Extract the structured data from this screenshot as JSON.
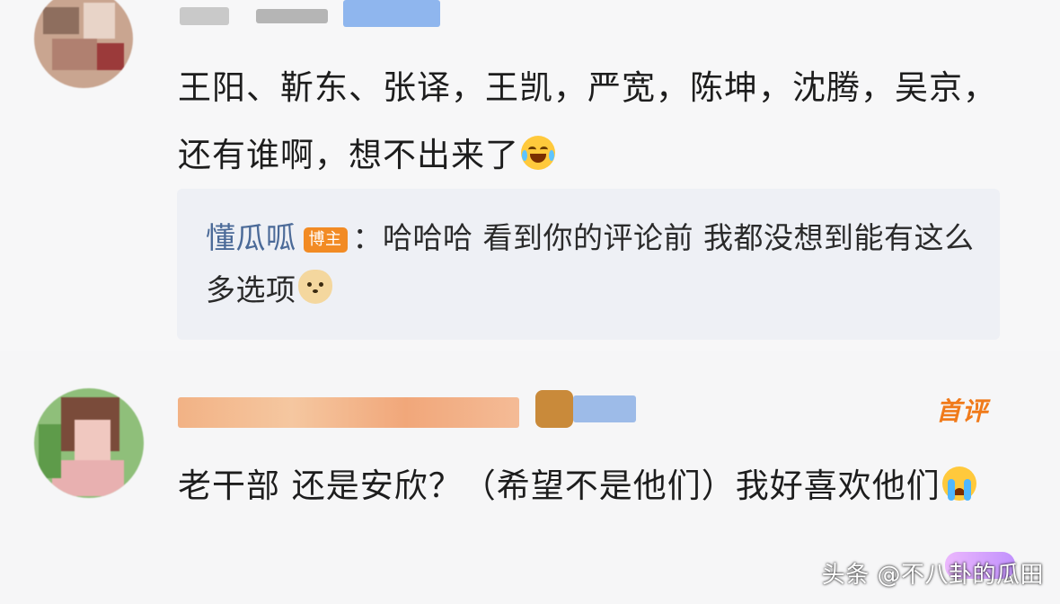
{
  "comments": [
    {
      "text": "王阳、靳东、张译，王凯，严宽，陈坤，沈腾，吴京，还有谁啊，想不出来了",
      "emoji": "laugh-cry-emoji",
      "reply": {
        "author": "懂瓜呱",
        "badge": "博主",
        "text_prefix": "：",
        "text": "哈哈哈 看到你的评论前 我都没想到能有这么多选项",
        "emoji": "dog-emoji"
      }
    },
    {
      "text": "老干部 还是安欣？（希望不是他们）我好喜欢他们",
      "emoji": "crying-emoji",
      "tag": "首评"
    }
  ],
  "watermark": "头条 @不八卦的瓜田",
  "colors": {
    "reply_author": "#4b6a98",
    "badge_bg": "#f28b24",
    "first_tag": "#f07a1a"
  }
}
